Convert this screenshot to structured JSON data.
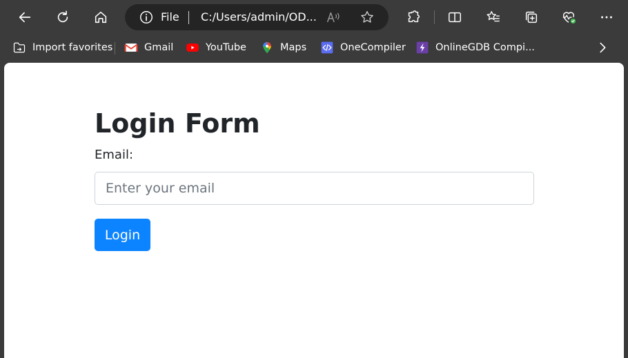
{
  "browser": {
    "address_bar": {
      "scheme_label": "File",
      "url": "C:/Users/admin/OD..."
    },
    "bookmarks": [
      {
        "label": "Import favorites",
        "icon": "import-folder-icon"
      },
      {
        "label": "Gmail",
        "icon": "gmail-icon"
      },
      {
        "label": "YouTube",
        "icon": "youtube-icon"
      },
      {
        "label": "Maps",
        "icon": "maps-pin-icon"
      },
      {
        "label": "OneCompiler",
        "icon": "onecompiler-icon"
      },
      {
        "label": "OnlineGDB Compi...",
        "icon": "onlinegdb-icon"
      }
    ],
    "colors": {
      "chrome_bg": "#3b3b3b",
      "address_bg": "#242424",
      "status_green": "#3fb950"
    }
  },
  "page": {
    "title": "Login Form",
    "email_label": "Email:",
    "email_placeholder": "Enter your email",
    "email_value": "",
    "login_button": "Login",
    "colors": {
      "primary": "#0d84ff",
      "text": "#212529",
      "input_border": "#ced4da"
    }
  }
}
